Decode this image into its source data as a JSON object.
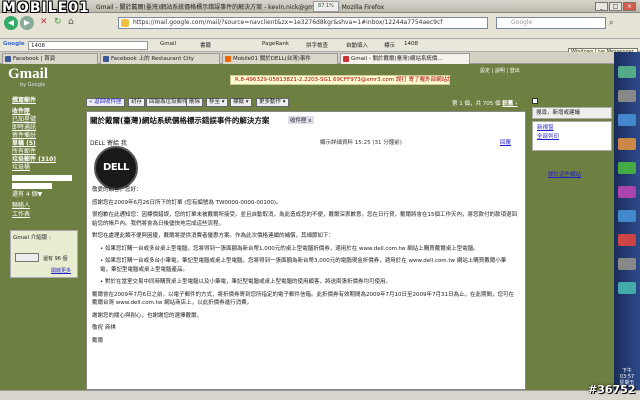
{
  "window": {
    "title": "Gmail - 關於戴爾(臺灣)網站系統價格標示錯誤事件的解決方案 - kevin.nick@gmail.com - Mozilla Firefox",
    "net_graph": "87.1%"
  },
  "logo": "MOBILE01",
  "address_bar": {
    "url": "https://mail.google.com/mail/?source=navclient&zx=1e3276d8kgr&shva=1#inbox/12244a7754aec9cf"
  },
  "search_box": {
    "placeholder": "Google"
  },
  "google_toolbar": {
    "search_value": "1408",
    "items": [
      "Gmail",
      "書籤",
      "PageRank",
      "拼字檢查",
      "自動填入",
      "標示",
      "1408"
    ]
  },
  "messenger_tip": "Windows Live Messenger",
  "tabs": [
    {
      "label": "Facebook | 首頁",
      "active": false
    },
    {
      "label": "Facebook 上的 Restaurant City",
      "active": false
    },
    {
      "label": "Mobile01 關於DELL(台灣)事件",
      "active": false
    },
    {
      "label": "Gmail - 關於戴爾(臺灣)網站系統價...",
      "active": true
    }
  ],
  "gmail": {
    "brand": "Gmail",
    "brand_sub": "by Google",
    "ad": "R.8-496329-05813821-2.2203-SG1.69CFF973@xmr3.com 誤打 寄了喔外部網站請會發佈聯絡。",
    "top_links": "設定 | 說明 | 登出"
  },
  "sidebar": {
    "compose": "撰寫郵件",
    "items": [
      {
        "label": "收件匣",
        "bold": true
      },
      {
        "label": "已加星號",
        "bold": false
      },
      {
        "label": "即時通訊",
        "bold": false
      },
      {
        "label": "寄件備份",
        "bold": false
      },
      {
        "label": "草稿 (5)",
        "bold": true
      },
      {
        "label": "所有郵件",
        "bold": false
      },
      {
        "label": "垃圾郵件 (310)",
        "bold": true
      },
      {
        "label": "垃圾桶",
        "bold": false
      }
    ],
    "contacts_label": "聯絡人",
    "more_label": "還有 4 個▼",
    "tasks_label": "工作表",
    "chat_header": "Gmail 介紹版 :",
    "chat_status": "還有 96 個",
    "chat_link": "開啟更多"
  },
  "actions": {
    "back": "« 返回收件匣",
    "archive": "封存",
    "spam": "回報為垃圾郵件",
    "delete": "刪除",
    "move": "移至 ▾",
    "labels": "標籤 ▾",
    "more": "更多動作 ▾",
    "paging": "第 1 個，共 705 個",
    "older": "較舊 ›"
  },
  "message": {
    "subject": "關於戴爾(臺灣)網站系統價格標示錯誤事件的解決方案",
    "inbox_tag": "收件匣 x",
    "sender": "DELL 寄給 我",
    "meta": "顯示詳細資料 15:25 (31 分鐘前)",
    "reply": "回覆",
    "greeting": "敬愛的顧客，您好：",
    "paragraphs": [
      "感謝您在2009年6月26日所下的訂單 (您有編號為 TW0000-0000-00100)。",
      "很抱歉在此通知您：因標價錯誤，您的訂單未被戴爾所接受。並且自動取消，為此造成您的不便，戴爾深表歉意。您在日行貸，戴爾將會在15個工作天內，將您款付的款項退回給您的帳戶內。我們將會為日後儘快地完成這些流程。",
      "對您在處理此類不便與困擾，戴爾將提供消費者優惠方案。作為此次價格連續的補償，其細節如下：",
      "• 如果您訂購一台或多台桌上型電腦，您將得到一張面額為新台幣1,000元的桌上型電腦折價券，適用於在 www.dell.com.tw 網站上購買戴爾桌上型電腦。",
      "• 如果您訂購一台或多台小筆電，筆記型電腦或桌上型電腦，您將得到一張面額為新台幣3,000元的電腦現金折價券，適用於在 www.dell.com.tw 網站上購買戴爾小筆電，筆記型電腦或桌上型電腦產品。",
      "• 對於在當室交易中同時購買桌上型電腦以及小筆電，筆記型電腦或桌上型電腦的使用顧客，將送兩張折價券均可使用。",
      "戴爾會在2009年7月6日之前，以電子郵件的方式，將折價券寄到您所指定的電子郵件信箱。此折價券有效期間為2009年7月10日至2009年7月31日為止。在此期間，您可在戴爾台灣 www.dell.com.tw 網站商店上，以此折價券進行消費。",
      "謝謝您的關心與耐心，也謝謝您的選擇戴爾。",
      "敬祝 商祺",
      "戴爾"
    ]
  },
  "right_panel": {
    "new_window": "新視窗",
    "print": "全部列印",
    "related": "關於這些網站",
    "box_label": "搜尋，新增或建議"
  },
  "clock": {
    "time": "下午 03:57",
    "day": "星期五"
  },
  "watermark": "#36752"
}
